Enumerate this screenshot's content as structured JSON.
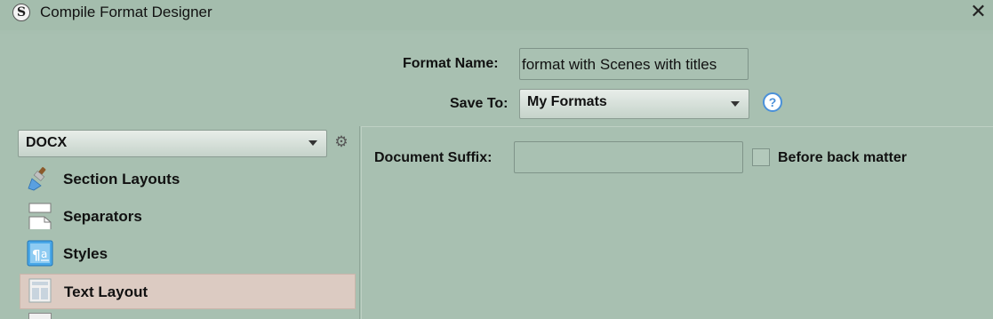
{
  "window": {
    "title": "Compile Format Designer",
    "logo_glyph": "S",
    "close_glyph": "✕"
  },
  "format_name": {
    "label": "Format Name:",
    "value": "format with Scenes with titles"
  },
  "save_to": {
    "label": "Save To:",
    "value": "My Formats",
    "help_glyph": "?"
  },
  "output_type": {
    "value": "DOCX"
  },
  "sidebar": {
    "items": [
      {
        "label": "Section Layouts",
        "icon": "paintbrush-icon"
      },
      {
        "label": "Separators",
        "icon": "separators-icon"
      },
      {
        "label": "Styles",
        "icon": "styles-icon"
      },
      {
        "label": "Text Layout",
        "icon": "text-layout-icon",
        "selected": true
      }
    ]
  },
  "main": {
    "document_suffix": {
      "label": "Document Suffix:",
      "value": ""
    },
    "before_back_matter": {
      "label": "Before back matter",
      "checked": false
    }
  },
  "colors": {
    "background": "#a8c0b1",
    "selected_item": "#dccbc2",
    "help_accent": "#4a90d9"
  }
}
